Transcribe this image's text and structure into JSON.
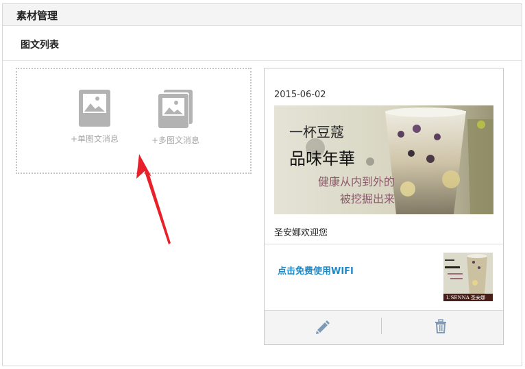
{
  "header": {
    "title": "素材管理"
  },
  "section": {
    "title": "图文列表"
  },
  "create": {
    "single_label": "+单图文消息",
    "multi_label": "+多图文消息"
  },
  "article": {
    "date": "2015-06-02",
    "cover_lines": [
      "一杯豆蔻",
      "品味年華",
      "健康从内到外的",
      "被挖掘出来"
    ],
    "title": "圣安娜欢迎您",
    "sub_title": "点击免费使用WIFI",
    "thumb_brand": "L'SENNA 圣安娜"
  },
  "colors": {
    "link": "#1e88c9",
    "icon_gray": "#b3b3b3",
    "action_icon": "#7e9ab6",
    "arrow": "#e8202a"
  }
}
